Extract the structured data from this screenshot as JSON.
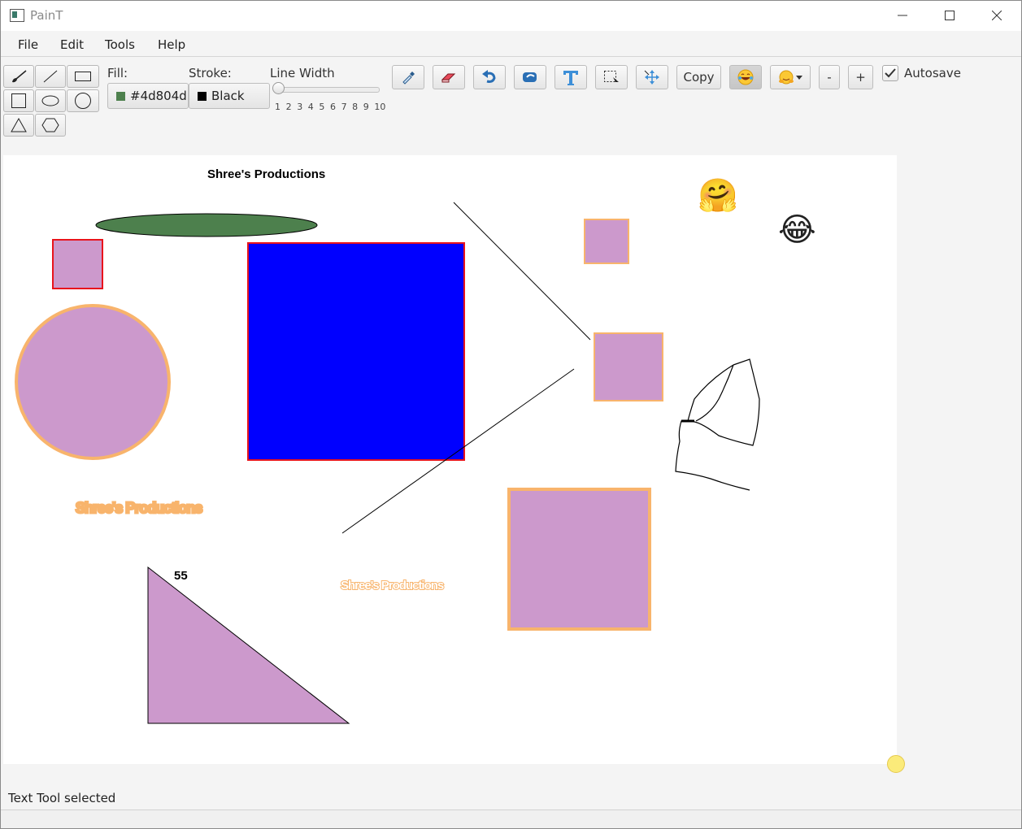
{
  "window": {
    "title": "PainT"
  },
  "menu": [
    "File",
    "Edit",
    "Tools",
    "Help"
  ],
  "toolbar": {
    "fill_label": "Fill:",
    "fill_value": "#4d804d",
    "fill_color": "#4d804d",
    "stroke_label": "Stroke:",
    "stroke_value": "Black",
    "stroke_color": "#000000",
    "line_width_label": "Line Width",
    "line_width_ticks": [
      "1",
      "2",
      "3",
      "4",
      "5",
      "6",
      "7",
      "8",
      "9",
      "10"
    ],
    "line_width_value": 1,
    "copy_label": "Copy",
    "minus_label": "-",
    "plus_label": "+",
    "autosave_label": "Autosave",
    "autosave_checked": true,
    "icons": [
      "brush-icon",
      "line-icon",
      "rectangle-icon",
      "square-icon",
      "ellipse-icon",
      "circle-icon",
      "triangle-icon",
      "hexagon-icon",
      "eyedropper-icon",
      "eraser-icon",
      "undo-icon",
      "redo-icon",
      "text-icon",
      "select-icon",
      "move-icon",
      "emoji-laugh-icon",
      "emoji-hug-icon"
    ]
  },
  "canvas": {
    "title_text": "Shree's Productions",
    "label_55": "55",
    "outlined_text_1": "Shree's Productions",
    "outlined_text_2": "Shree's Productions",
    "emoji_hug": "🤗",
    "emoji_laugh": "😂",
    "shape_colors": {
      "lilac": "#cc99cc",
      "orange": "#f8b46c",
      "red": "#e8141c",
      "blue": "#0000ff",
      "green": "#4d804d"
    }
  },
  "status": {
    "text": "Text Tool selected"
  }
}
